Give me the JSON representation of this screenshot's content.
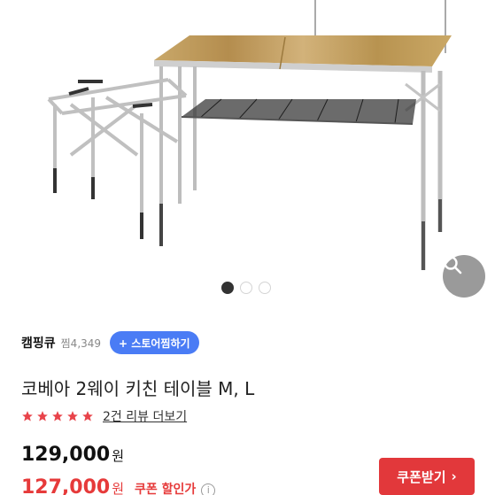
{
  "product_image": {
    "alt_icon": "kitchen-table-photo",
    "zoom_icon": "search-icon",
    "carousel": {
      "count": 3,
      "active_index": 0
    }
  },
  "store": {
    "name": "캠핑큐",
    "favorites": "찜4,349",
    "follow_label": "+ 스토어찜하기"
  },
  "product": {
    "title": "코베아 2웨이 키친 테이블 M, L",
    "rating_stars": 5,
    "review_link": "2건 리뷰 더보기"
  },
  "pricing": {
    "original_price": "129,000",
    "original_unit": "원",
    "sale_price": "127,000",
    "sale_unit": "원",
    "sale_label": "쿠폰 할인가",
    "info_icon": "i"
  },
  "coupon_button": {
    "label": "쿠폰받기",
    "arrow": "›"
  },
  "colors": {
    "accent_blue": "#4a7cf5",
    "sale_red": "#e63a3a",
    "coupon_red": "#e2383b",
    "star_red": "#e8434a"
  }
}
